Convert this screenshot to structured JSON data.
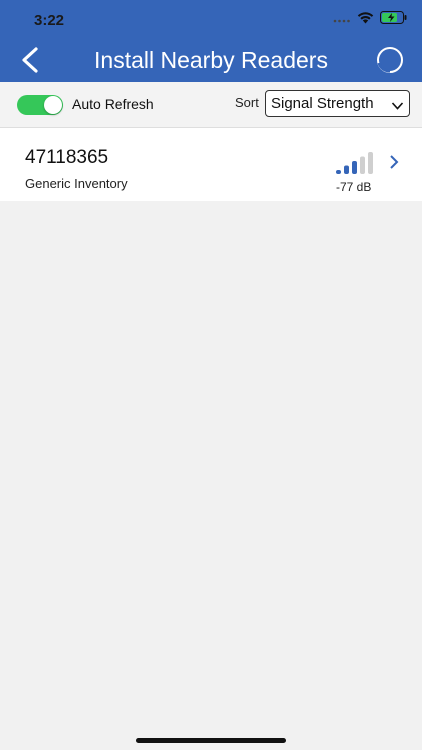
{
  "status_bar": {
    "time": "3:22",
    "icons": [
      "cellular-dots-icon",
      "wifi-icon",
      "battery-charging-icon"
    ]
  },
  "nav": {
    "title": "Install Nearby Readers",
    "back_icon": "chevron-left-icon",
    "refresh_icon": "refresh-circle-icon"
  },
  "toolbar": {
    "auto_refresh_label": "Auto Refresh",
    "auto_refresh_on": true,
    "sort_label": "Sort",
    "sort_value": "Signal Strength"
  },
  "readers": [
    {
      "id": "47118365",
      "type": "Generic Inventory",
      "signal": "-77 dB",
      "signal_bars_active": 3,
      "signal_bars_total": 5
    }
  ],
  "colors": {
    "header": "#3565b8",
    "toggle_on": "#35c759",
    "signal_active": "#3565b8",
    "signal_inactive": "#cfcfcf",
    "background": "#f1f1f1"
  }
}
